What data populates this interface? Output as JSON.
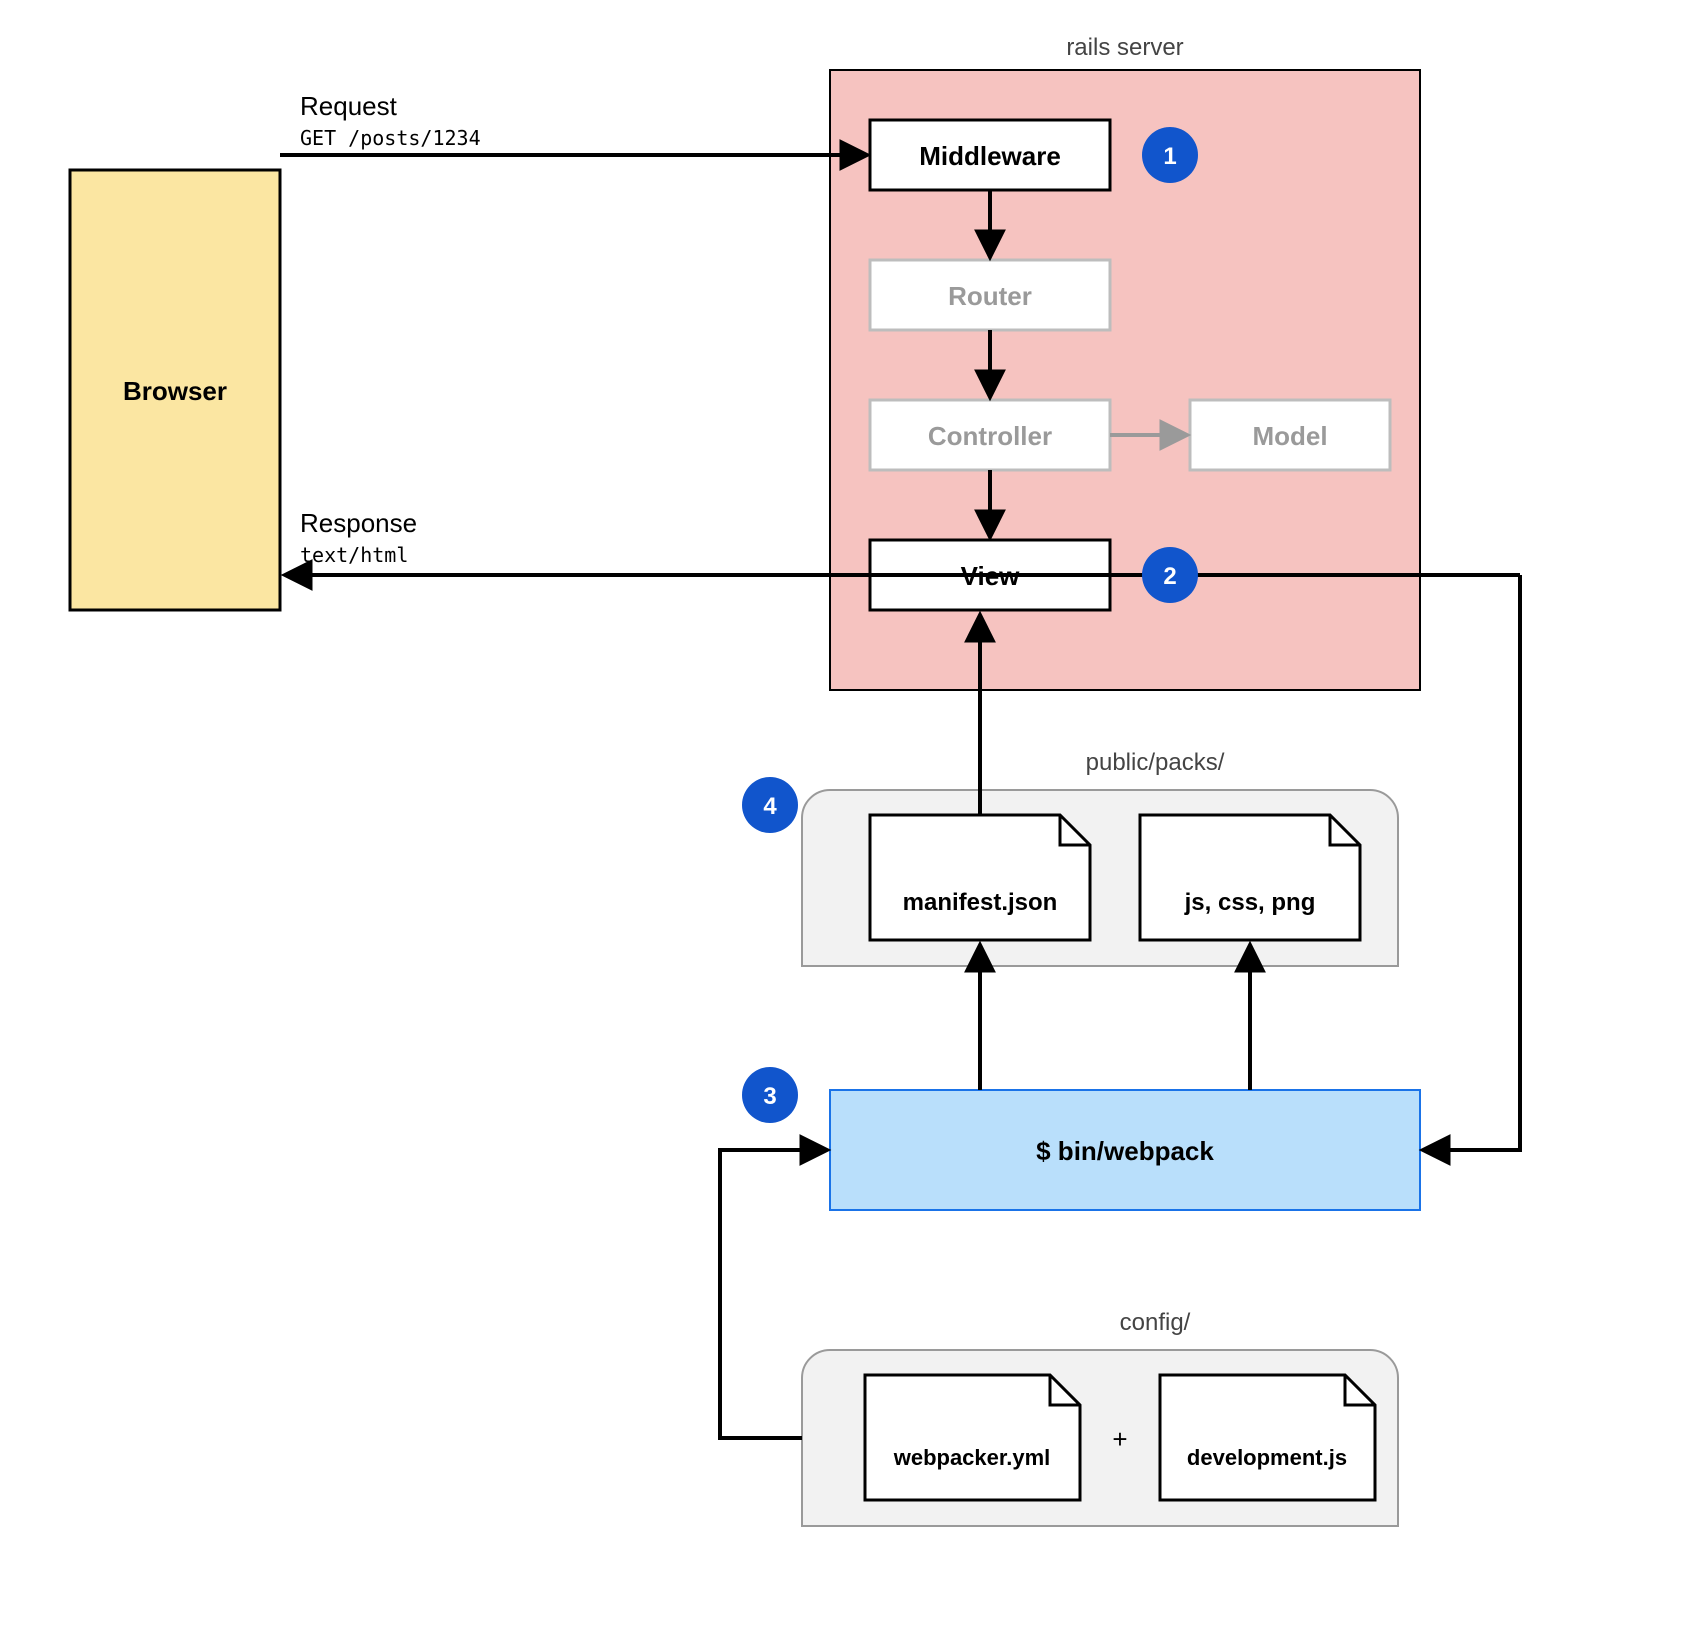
{
  "browser": {
    "label": "Browser"
  },
  "request": {
    "title": "Request",
    "detail": "GET /posts/1234"
  },
  "response": {
    "title": "Response",
    "detail": "text/html"
  },
  "rails_server": {
    "title": "rails server",
    "middleware": "Middleware",
    "router": "Router",
    "controller": "Controller",
    "model": "Model",
    "view": "View"
  },
  "packs": {
    "title": "public/packs/",
    "manifest": "manifest.json",
    "assets": "js, css, png"
  },
  "webpack": {
    "cmd": "$ bin/webpack"
  },
  "config": {
    "title": "config/",
    "webpacker": "webpacker.yml",
    "env": "development.js",
    "plus": "+"
  },
  "badges": {
    "b1": "1",
    "b2": "2",
    "b3": "3",
    "b4": "4"
  },
  "colors": {
    "browser_fill": "#fbe6a2",
    "rails_fill": "#f6c3c0",
    "webpack_fill": "#b9dffb",
    "group_fill": "#f2f2f2",
    "badge_fill": "#1155cc",
    "dim_stroke": "#bdbdbd",
    "black": "#000000"
  }
}
